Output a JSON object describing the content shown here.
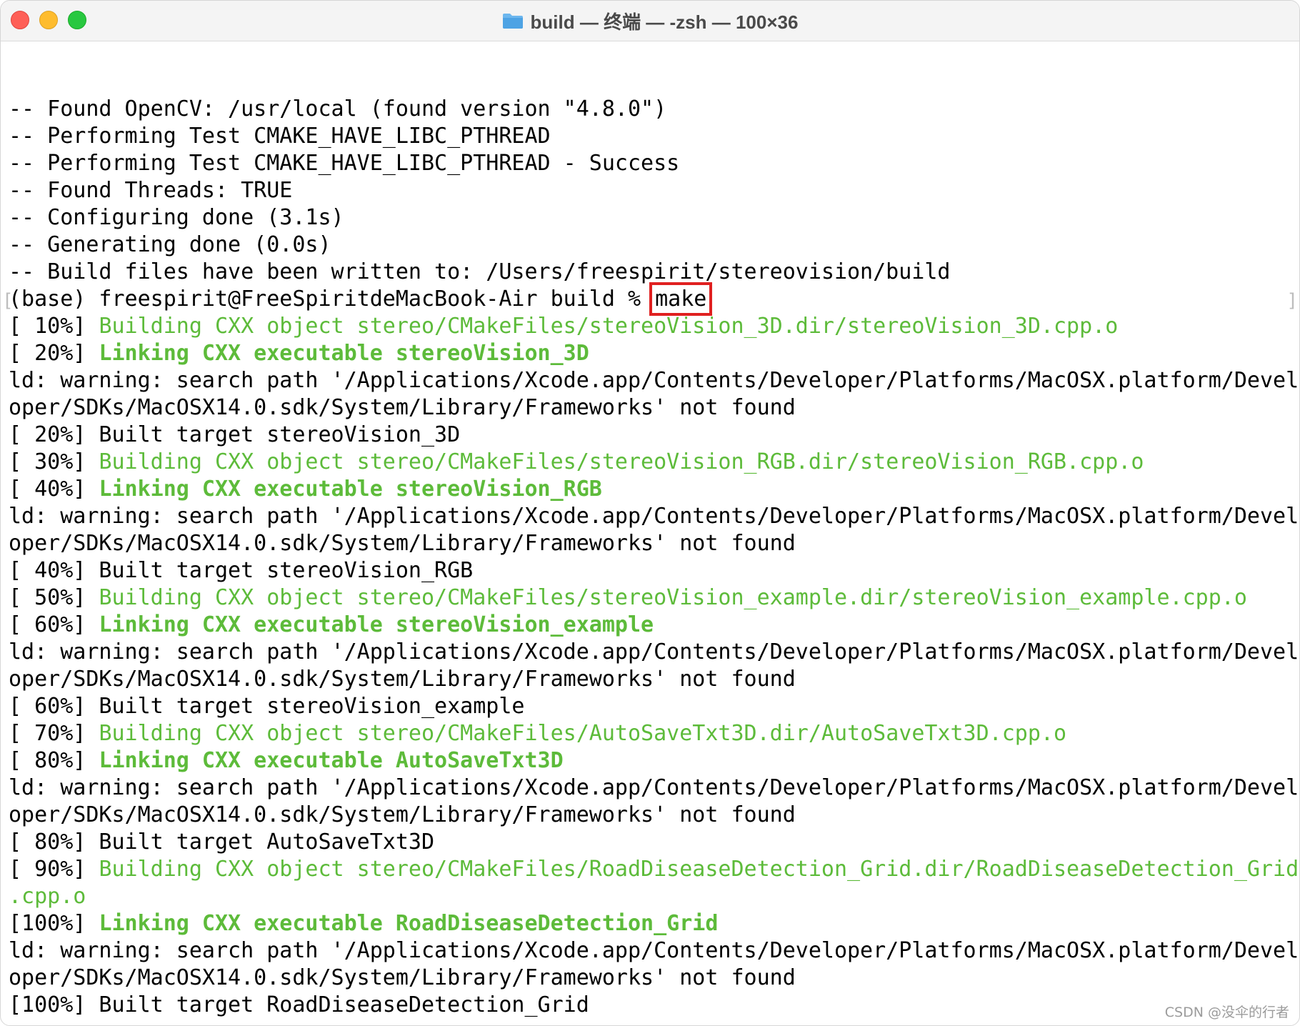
{
  "window": {
    "title": "build — 终端 — -zsh — 100×36",
    "icon": "folder-icon"
  },
  "terminal": {
    "lines": [
      {
        "text": "-- Found OpenCV: /usr/local (found version \"4.8.0\")",
        "style": "plain"
      },
      {
        "text": "-- Performing Test CMAKE_HAVE_LIBC_PTHREAD",
        "style": "plain"
      },
      {
        "text": "-- Performing Test CMAKE_HAVE_LIBC_PTHREAD - Success",
        "style": "plain"
      },
      {
        "text": "-- Found Threads: TRUE",
        "style": "plain"
      },
      {
        "text": "-- Configuring done (3.1s)",
        "style": "plain"
      },
      {
        "text": "-- Generating done (0.0s)",
        "style": "plain"
      },
      {
        "text": "-- Build files have been written to: /Users/freespirit/stereovision/build",
        "style": "plain"
      },
      {
        "text": "(base) freespirit@FreeSpiritdeMacBook-Air build % ",
        "style": "prompt",
        "command": "make"
      },
      {
        "text": "[ 10%] ",
        "style": "build",
        "rest": "Building CXX object stereo/CMakeFiles/stereoVision_3D.dir/stereoVision_3D.cpp.o"
      },
      {
        "text": "[ 20%] ",
        "style": "link",
        "rest": "Linking CXX executable stereoVision_3D"
      },
      {
        "text": "ld: warning: search path '/Applications/Xcode.app/Contents/Developer/Platforms/MacOSX.platform/Devel",
        "style": "plain"
      },
      {
        "text": "oper/SDKs/MacOSX14.0.sdk/System/Library/Frameworks' not found",
        "style": "plain"
      },
      {
        "text": "[ 20%] Built target stereoVision_3D",
        "style": "plain"
      },
      {
        "text": "[ 30%] ",
        "style": "build",
        "rest": "Building CXX object stereo/CMakeFiles/stereoVision_RGB.dir/stereoVision_RGB.cpp.o"
      },
      {
        "text": "[ 40%] ",
        "style": "link",
        "rest": "Linking CXX executable stereoVision_RGB"
      },
      {
        "text": "ld: warning: search path '/Applications/Xcode.app/Contents/Developer/Platforms/MacOSX.platform/Devel",
        "style": "plain"
      },
      {
        "text": "oper/SDKs/MacOSX14.0.sdk/System/Library/Frameworks' not found",
        "style": "plain"
      },
      {
        "text": "[ 40%] Built target stereoVision_RGB",
        "style": "plain"
      },
      {
        "text": "[ 50%] ",
        "style": "build",
        "rest": "Building CXX object stereo/CMakeFiles/stereoVision_example.dir/stereoVision_example.cpp.o"
      },
      {
        "text": "[ 60%] ",
        "style": "link",
        "rest": "Linking CXX executable stereoVision_example"
      },
      {
        "text": "ld: warning: search path '/Applications/Xcode.app/Contents/Developer/Platforms/MacOSX.platform/Devel",
        "style": "plain"
      },
      {
        "text": "oper/SDKs/MacOSX14.0.sdk/System/Library/Frameworks' not found",
        "style": "plain"
      },
      {
        "text": "[ 60%] Built target stereoVision_example",
        "style": "plain"
      },
      {
        "text": "[ 70%] ",
        "style": "build",
        "rest": "Building CXX object stereo/CMakeFiles/AutoSaveTxt3D.dir/AutoSaveTxt3D.cpp.o"
      },
      {
        "text": "[ 80%] ",
        "style": "link",
        "rest": "Linking CXX executable AutoSaveTxt3D"
      },
      {
        "text": "ld: warning: search path '/Applications/Xcode.app/Contents/Developer/Platforms/MacOSX.platform/Devel",
        "style": "plain"
      },
      {
        "text": "oper/SDKs/MacOSX14.0.sdk/System/Library/Frameworks' not found",
        "style": "plain"
      },
      {
        "text": "[ 80%] Built target AutoSaveTxt3D",
        "style": "plain"
      },
      {
        "text": "[ 90%] ",
        "style": "build",
        "rest": "Building CXX object stereo/CMakeFiles/RoadDiseaseDetection_Grid.dir/RoadDiseaseDetection_Grid"
      },
      {
        "text": "",
        "style": "build",
        "rest": ".cpp.o"
      },
      {
        "text": "[100%] ",
        "style": "link",
        "rest": "Linking CXX executable RoadDiseaseDetection_Grid"
      },
      {
        "text": "ld: warning: search path '/Applications/Xcode.app/Contents/Developer/Platforms/MacOSX.platform/Devel",
        "style": "plain"
      },
      {
        "text": "oper/SDKs/MacOSX14.0.sdk/System/Library/Frameworks' not found",
        "style": "plain"
      },
      {
        "text": "[100%] Built target RoadDiseaseDetection_Grid",
        "style": "plain"
      }
    ]
  },
  "watermark": "CSDN @没伞的行者",
  "colors": {
    "green": "#5dbb3a",
    "highlight_box": "#e02020"
  }
}
